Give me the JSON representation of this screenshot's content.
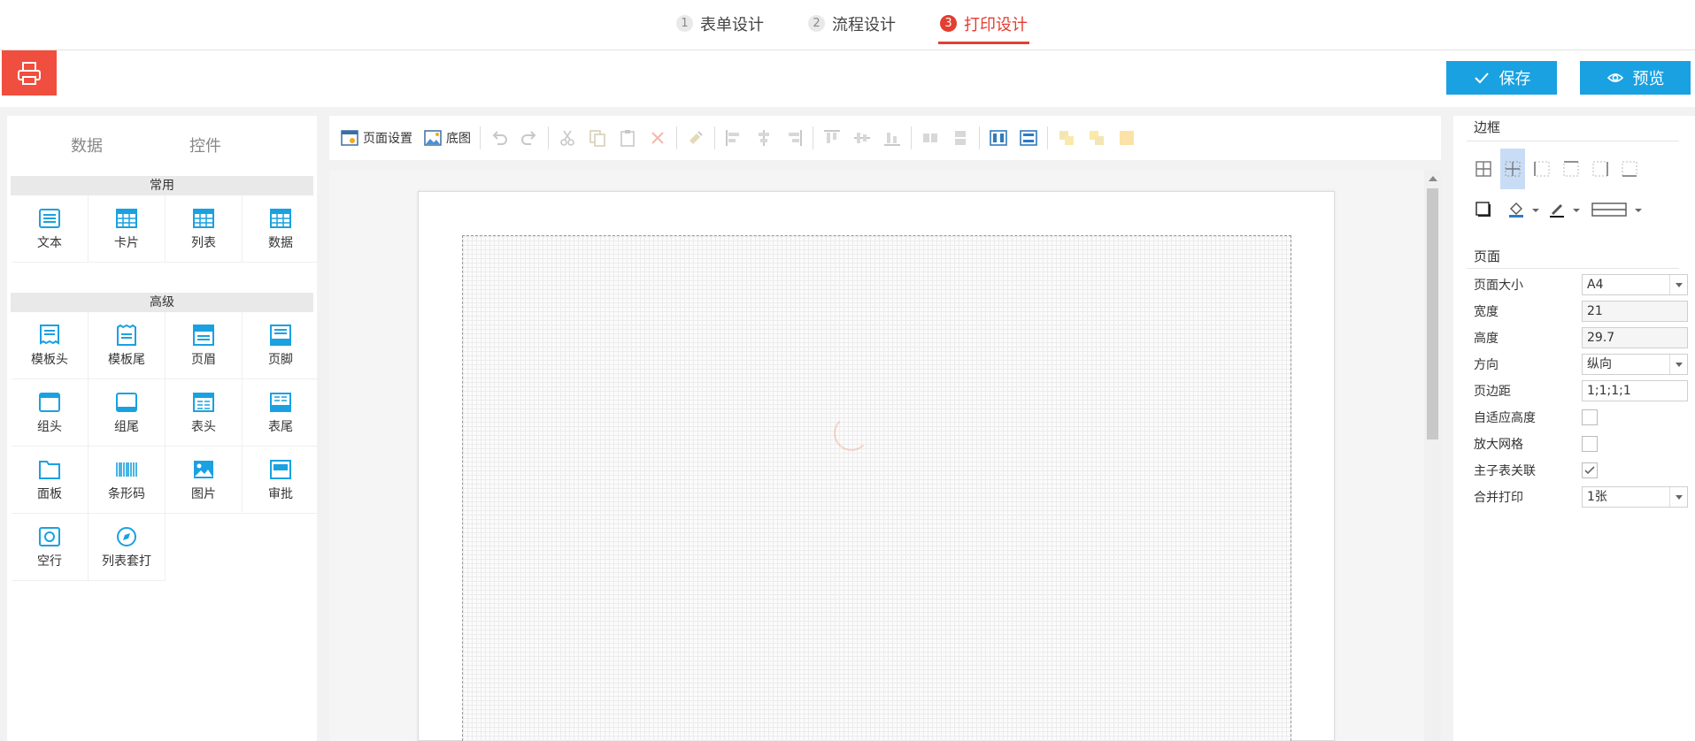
{
  "steps": [
    {
      "num": "1",
      "label": "表单设计",
      "active": false
    },
    {
      "num": "2",
      "label": "流程设计",
      "active": false
    },
    {
      "num": "3",
      "label": "打印设计",
      "active": true
    }
  ],
  "header": {
    "save_label": "保存",
    "preview_label": "预览",
    "accent": "#1aa1e1",
    "brand": "#f04e3e"
  },
  "left_panel": {
    "tabs": [
      "数据",
      "控件"
    ],
    "sections": [
      {
        "title": "常用",
        "items": [
          "文本",
          "卡片",
          "列表",
          "数据"
        ]
      },
      {
        "title": "高级",
        "items": [
          "模板头",
          "模板尾",
          "页眉",
          "页脚",
          "组头",
          "组尾",
          "表头",
          "表尾",
          "面板",
          "条形码",
          "图片",
          "审批",
          "空行",
          "列表套打"
        ]
      }
    ]
  },
  "toolbar": {
    "page_setup": "页面设置",
    "background": "底图"
  },
  "right_panel": {
    "border_title": "边框",
    "page_title": "页面",
    "props": {
      "page_size": {
        "label": "页面大小",
        "value": "A4"
      },
      "width": {
        "label": "宽度",
        "value": "21"
      },
      "height": {
        "label": "高度",
        "value": "29.7"
      },
      "orientation": {
        "label": "方向",
        "value": "纵向"
      },
      "margin": {
        "label": "页边距",
        "value": "1;1;1;1"
      },
      "auto_height": {
        "label": "自适应高度",
        "checked": false
      },
      "zoom_grid": {
        "label": "放大网格",
        "checked": false
      },
      "master_detail": {
        "label": "主子表关联",
        "checked": true
      },
      "merge_print": {
        "label": "合并打印",
        "value": "1张"
      }
    }
  }
}
